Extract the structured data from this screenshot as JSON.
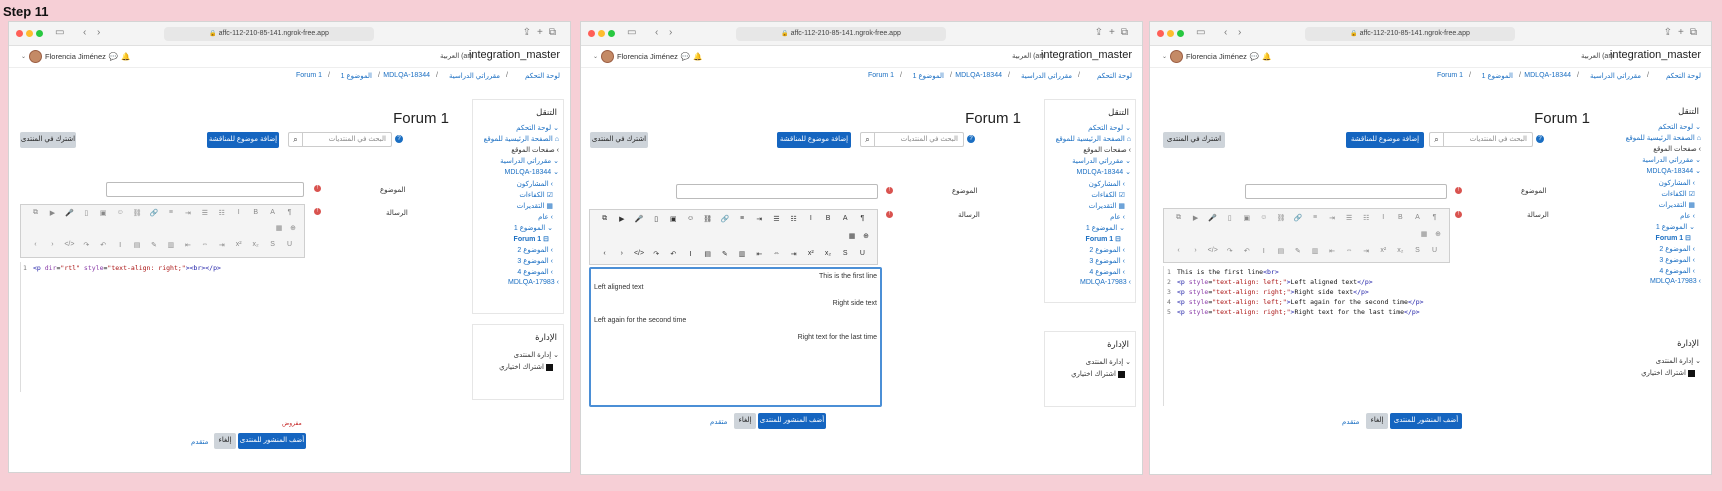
{
  "step_title": "Step 11",
  "browser": {
    "url": "affc-112-210-85-141.ngrok-free.app"
  },
  "header": {
    "site_name": "integration_master",
    "language": "العربية (ar)",
    "user_name": "Florencia Jiménez"
  },
  "breadcrumb": [
    "لوحة التحكم",
    "مقرراتي الدراسية",
    "MDLQA-18344",
    "الموضوع 1",
    "Forum 1"
  ],
  "nav": {
    "title": "التنقل",
    "items": [
      "لوحة التحكم",
      "الصفحة الرئيسية للموقع",
      "صفحات الموقع",
      "مقرراتي الدراسية",
      "MDLQA-18344",
      "المشاركون",
      "الكفاءات",
      "التقديرات",
      "عام",
      "الموضوع 1",
      "Forum 1",
      "الموضوع 2",
      "الموضوع 3",
      "الموضوع 4",
      "MDLQA-17983"
    ]
  },
  "admin": {
    "title": "الإدارة",
    "items": [
      "إدارة المنتدى",
      "اشتراك اختياري"
    ]
  },
  "forum": {
    "title": "Forum 1",
    "search_placeholder": "البحث في المنتديات",
    "add_topic": "إضافة موضوع للمناقشة",
    "subscribe": "اشترك في المنتدى",
    "subject_label": "الموضوع",
    "message_label": "الرسالة",
    "post_button": "أضف المنشور للمنتدى",
    "cancel_button": "إلغاء",
    "advanced_link": "متقدم",
    "required_note": "مفروض"
  },
  "panel1": {
    "code_line": "1"
  },
  "panel2": {
    "lines": [
      "This is the first line",
      "Left aligned text",
      "Right side text",
      "Left again for the second time",
      "Right text for the last time"
    ]
  },
  "panel3": {
    "line_numbers": [
      "1",
      "2",
      "3",
      "4",
      "5"
    ]
  },
  "colors": {
    "primary": "#1565c0",
    "link": "#1a6ec2",
    "required": "#d9534f",
    "background": "#f6cfd6"
  }
}
